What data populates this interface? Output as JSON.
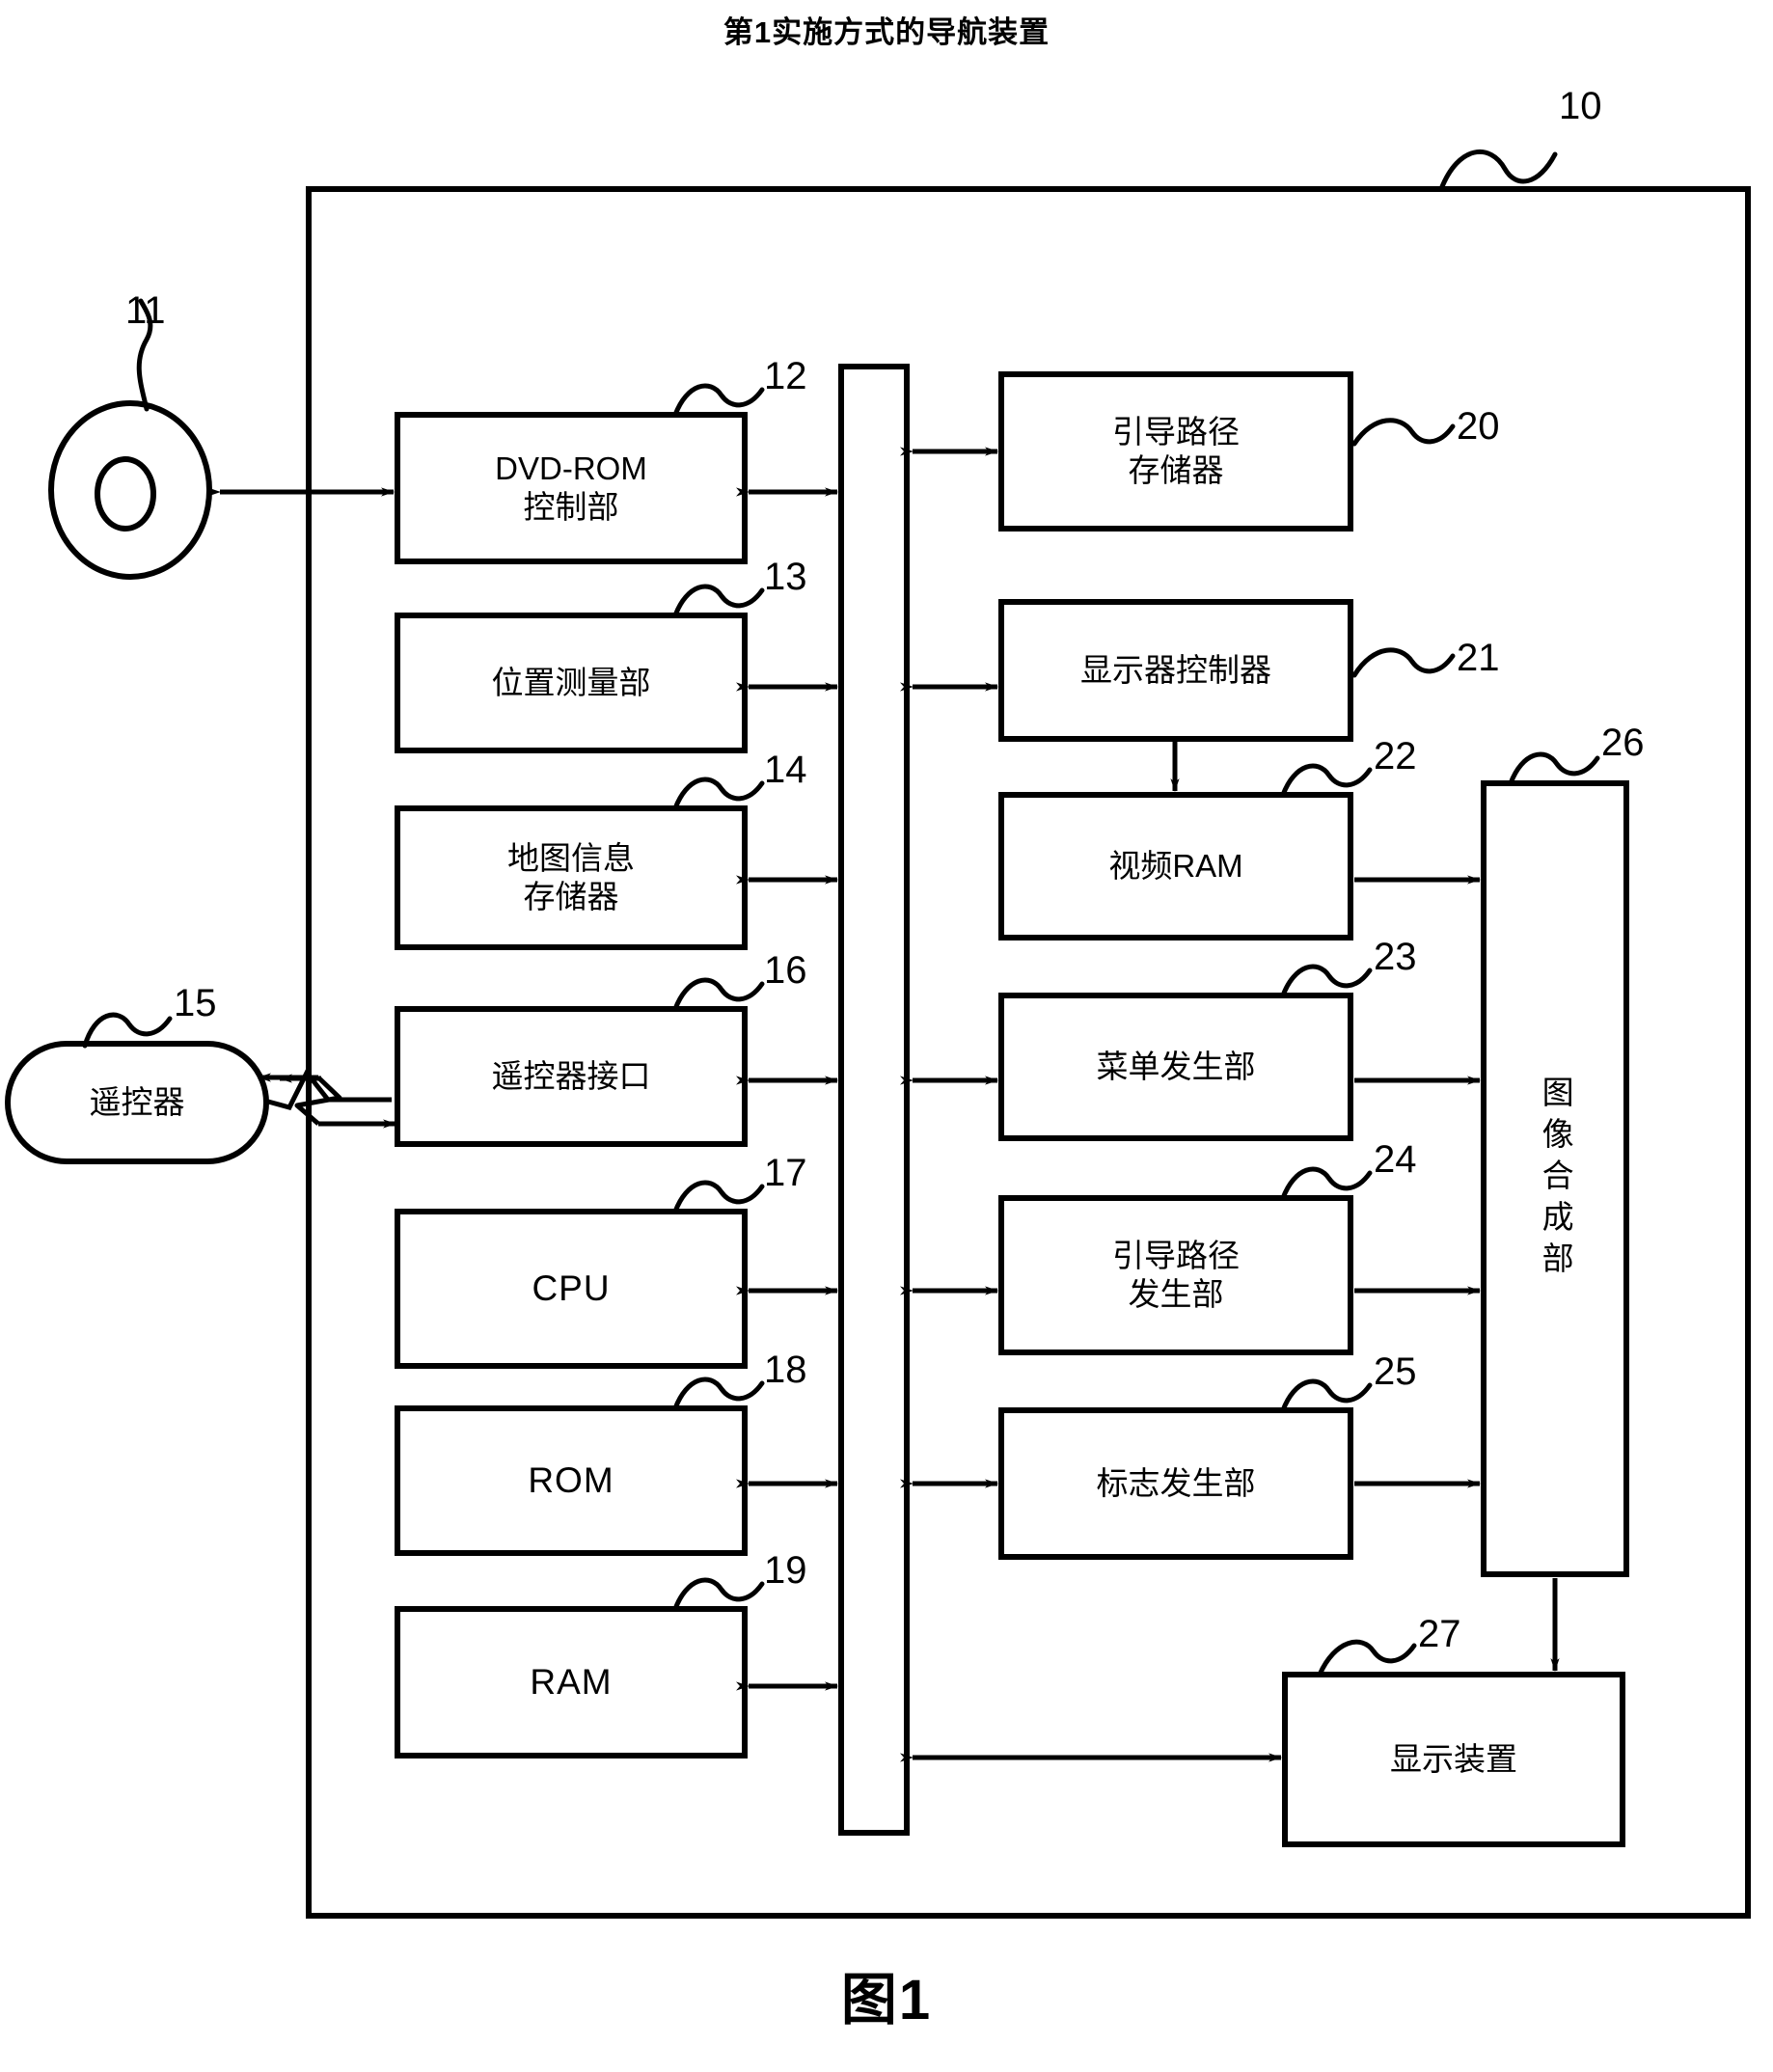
{
  "title": "第1实施方式的导航装置",
  "figure_label": "图1",
  "system": {
    "ref": "10"
  },
  "nodes": [
    {
      "id": "disc",
      "ref": "11",
      "label": "",
      "shape": "disc"
    },
    {
      "id": "dvd-rom-ctrl",
      "ref": "12",
      "label": "DVD-ROM\n控制部",
      "shape": "rect"
    },
    {
      "id": "position-meas",
      "ref": "13",
      "label": "位置测量部",
      "shape": "rect"
    },
    {
      "id": "map-info-mem",
      "ref": "14",
      "label": "地图信息\n存储器",
      "shape": "rect"
    },
    {
      "id": "remote",
      "ref": "15",
      "label": "遥控器",
      "shape": "stadium"
    },
    {
      "id": "remote-if",
      "ref": "16",
      "label": "遥控器接口",
      "shape": "rect"
    },
    {
      "id": "cpu",
      "ref": "17",
      "label": "CPU",
      "shape": "rect"
    },
    {
      "id": "rom",
      "ref": "18",
      "label": "ROM",
      "shape": "rect"
    },
    {
      "id": "ram",
      "ref": "19",
      "label": "RAM",
      "shape": "rect"
    },
    {
      "id": "guide-route-mem",
      "ref": "20",
      "label": "引导路径\n存储器",
      "shape": "rect"
    },
    {
      "id": "display-ctrl",
      "ref": "21",
      "label": "显示器控制器",
      "shape": "rect"
    },
    {
      "id": "video-ram",
      "ref": "22",
      "label": "视频RAM",
      "shape": "rect"
    },
    {
      "id": "menu-gen",
      "ref": "23",
      "label": "菜单发生部",
      "shape": "rect"
    },
    {
      "id": "guide-route-gen",
      "ref": "24",
      "label": "引导路径\n发生部",
      "shape": "rect"
    },
    {
      "id": "mark-gen",
      "ref": "25",
      "label": "标志发生部",
      "shape": "rect"
    },
    {
      "id": "image-compose",
      "ref": "26",
      "label": "图像合成部",
      "shape": "rect-vertical"
    },
    {
      "id": "display-dev",
      "ref": "27",
      "label": "显示装置",
      "shape": "rect"
    },
    {
      "id": "bus",
      "ref": "",
      "label": "",
      "shape": "bus"
    }
  ],
  "colors": {
    "line": "#000000",
    "background": "#ffffff"
  }
}
